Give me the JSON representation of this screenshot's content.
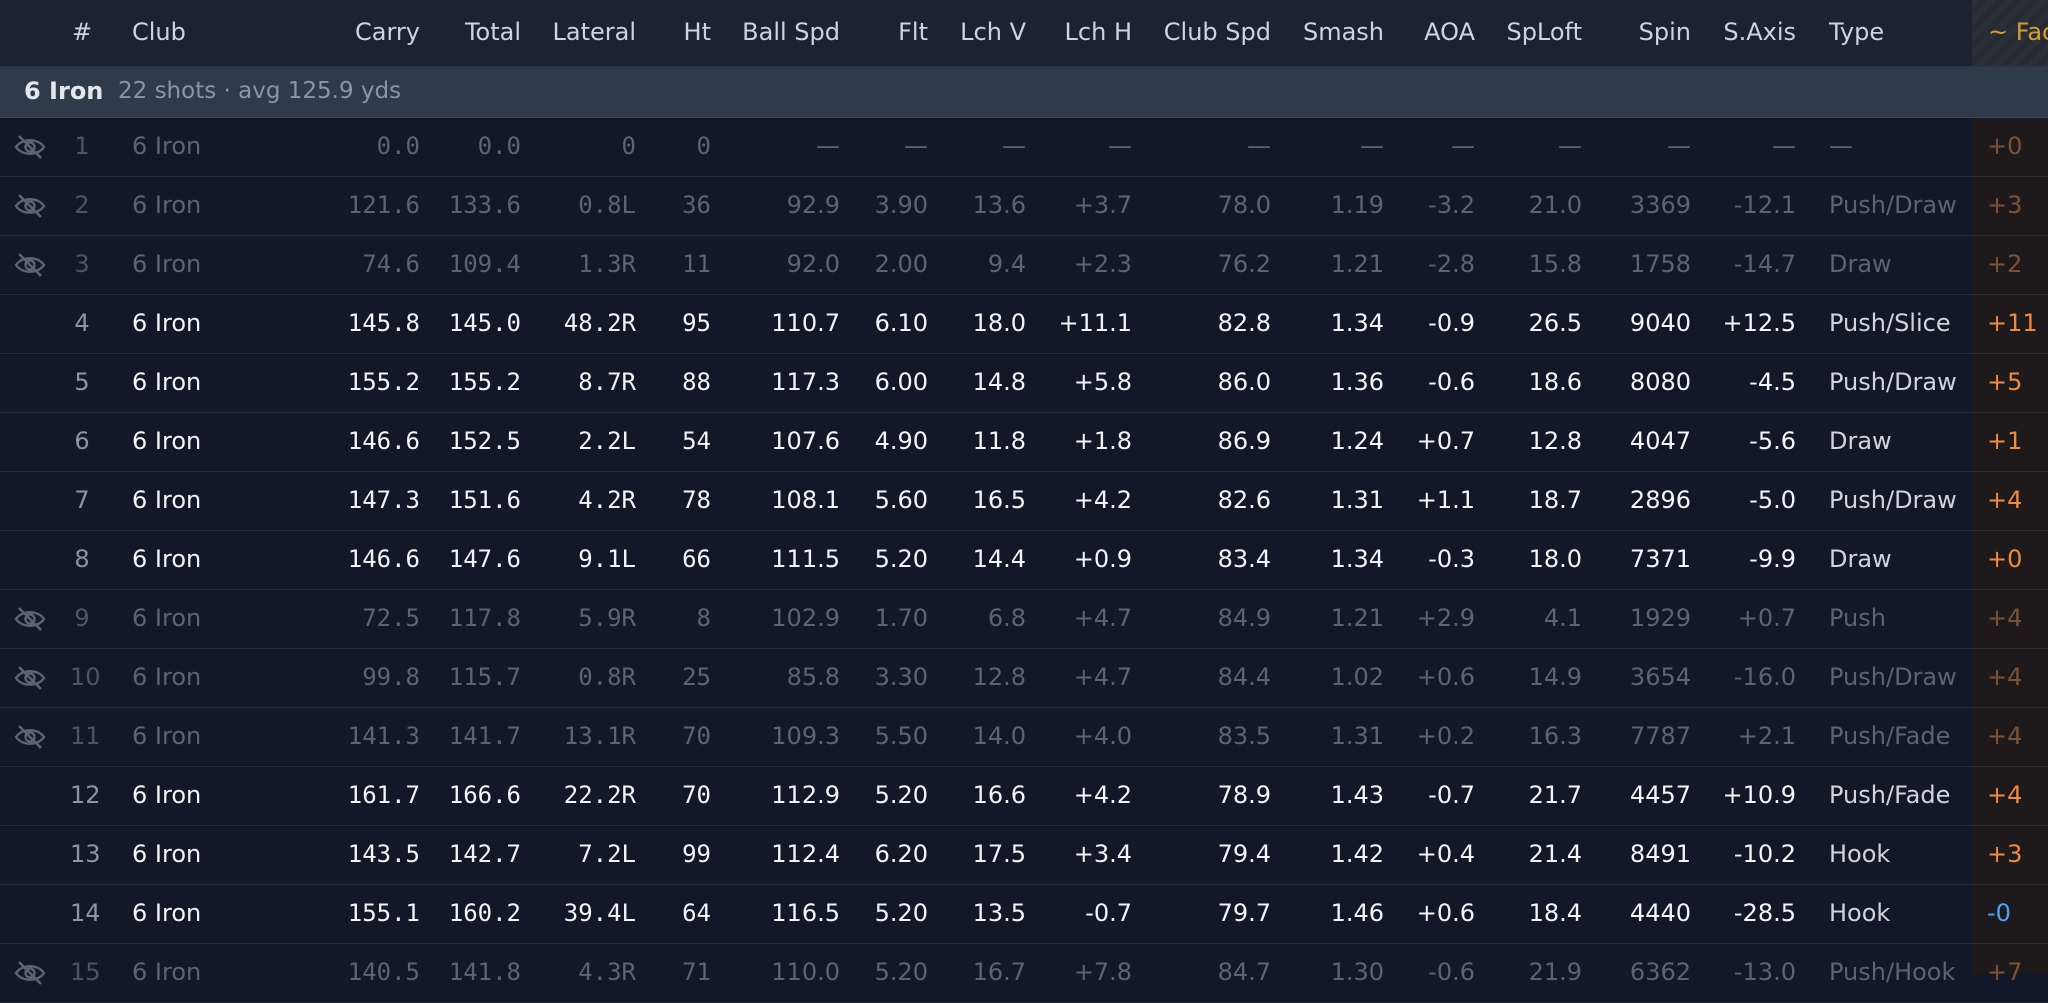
{
  "columns": {
    "hash": "#",
    "club": "Club",
    "carry": "Carry",
    "total": "Total",
    "lateral": "Lateral",
    "ht": "Ht",
    "ball_spd": "Ball Spd",
    "flt": "Flt",
    "lch_v": "Lch V",
    "lch_h": "Lch H",
    "club_spd": "Club Spd",
    "smash": "Smash",
    "aoa": "AOA",
    "sploft": "SpLoft",
    "spin": "Spin",
    "s_axis": "S.Axis",
    "type": "Type",
    "face": "~ Fac"
  },
  "group": {
    "name": "6 Iron",
    "meta": "22 shots · avg 125.9 yds"
  },
  "colors": {
    "background": "#111827",
    "face_positive": "#f08a3c",
    "face_negative": "#4aa3ff",
    "face_header": "#d69e2e"
  },
  "rows": [
    {
      "hidden": true,
      "n": "1",
      "club": "6 Iron",
      "carry": "0.0",
      "total": "0.0",
      "lateral": "0",
      "ht": "0",
      "ball_spd": "—",
      "flt": "—",
      "lch_v": "—",
      "lch_h": "—",
      "club_spd": "—",
      "smash": "—",
      "aoa": "—",
      "sploft": "—",
      "spin": "—",
      "s_axis": "—",
      "type": "—",
      "face": "+0"
    },
    {
      "hidden": true,
      "n": "2",
      "club": "6 Iron",
      "carry": "121.6",
      "total": "133.6",
      "lateral": "0.8L",
      "ht": "36",
      "ball_spd": "92.9",
      "flt": "3.90",
      "lch_v": "13.6",
      "lch_h": "+3.7",
      "club_spd": "78.0",
      "smash": "1.19",
      "aoa": "-3.2",
      "sploft": "21.0",
      "spin": "3369",
      "s_axis": "-12.1",
      "type": "Push/Draw",
      "face": "+3"
    },
    {
      "hidden": true,
      "n": "3",
      "club": "6 Iron",
      "carry": "74.6",
      "total": "109.4",
      "lateral": "1.3R",
      "ht": "11",
      "ball_spd": "92.0",
      "flt": "2.00",
      "lch_v": "9.4",
      "lch_h": "+2.3",
      "club_spd": "76.2",
      "smash": "1.21",
      "aoa": "-2.8",
      "sploft": "15.8",
      "spin": "1758",
      "s_axis": "-14.7",
      "type": "Draw",
      "face": "+2"
    },
    {
      "hidden": false,
      "n": "4",
      "club": "6 Iron",
      "carry": "145.8",
      "total": "145.0",
      "lateral": "48.2R",
      "ht": "95",
      "ball_spd": "110.7",
      "flt": "6.10",
      "lch_v": "18.0",
      "lch_h": "+11.1",
      "club_spd": "82.8",
      "smash": "1.34",
      "aoa": "-0.9",
      "sploft": "26.5",
      "spin": "9040",
      "s_axis": "+12.5",
      "type": "Push/Slice",
      "face": "+11"
    },
    {
      "hidden": false,
      "n": "5",
      "club": "6 Iron",
      "carry": "155.2",
      "total": "155.2",
      "lateral": "8.7R",
      "ht": "88",
      "ball_spd": "117.3",
      "flt": "6.00",
      "lch_v": "14.8",
      "lch_h": "+5.8",
      "club_spd": "86.0",
      "smash": "1.36",
      "aoa": "-0.6",
      "sploft": "18.6",
      "spin": "8080",
      "s_axis": "-4.5",
      "type": "Push/Draw",
      "face": "+5"
    },
    {
      "hidden": false,
      "n": "6",
      "club": "6 Iron",
      "carry": "146.6",
      "total": "152.5",
      "lateral": "2.2L",
      "ht": "54",
      "ball_spd": "107.6",
      "flt": "4.90",
      "lch_v": "11.8",
      "lch_h": "+1.8",
      "club_spd": "86.9",
      "smash": "1.24",
      "aoa": "+0.7",
      "sploft": "12.8",
      "spin": "4047",
      "s_axis": "-5.6",
      "type": "Draw",
      "face": "+1"
    },
    {
      "hidden": false,
      "n": "7",
      "club": "6 Iron",
      "carry": "147.3",
      "total": "151.6",
      "lateral": "4.2R",
      "ht": "78",
      "ball_spd": "108.1",
      "flt": "5.60",
      "lch_v": "16.5",
      "lch_h": "+4.2",
      "club_spd": "82.6",
      "smash": "1.31",
      "aoa": "+1.1",
      "sploft": "18.7",
      "spin": "2896",
      "s_axis": "-5.0",
      "type": "Push/Draw",
      "face": "+4"
    },
    {
      "hidden": false,
      "n": "8",
      "club": "6 Iron",
      "carry": "146.6",
      "total": "147.6",
      "lateral": "9.1L",
      "ht": "66",
      "ball_spd": "111.5",
      "flt": "5.20",
      "lch_v": "14.4",
      "lch_h": "+0.9",
      "club_spd": "83.4",
      "smash": "1.34",
      "aoa": "-0.3",
      "sploft": "18.0",
      "spin": "7371",
      "s_axis": "-9.9",
      "type": "Draw",
      "face": "+0"
    },
    {
      "hidden": true,
      "n": "9",
      "club": "6 Iron",
      "carry": "72.5",
      "total": "117.8",
      "lateral": "5.9R",
      "ht": "8",
      "ball_spd": "102.9",
      "flt": "1.70",
      "lch_v": "6.8",
      "lch_h": "+4.7",
      "club_spd": "84.9",
      "smash": "1.21",
      "aoa": "+2.9",
      "sploft": "4.1",
      "spin": "1929",
      "s_axis": "+0.7",
      "type": "Push",
      "face": "+4"
    },
    {
      "hidden": true,
      "n": "10",
      "club": "6 Iron",
      "carry": "99.8",
      "total": "115.7",
      "lateral": "0.8R",
      "ht": "25",
      "ball_spd": "85.8",
      "flt": "3.30",
      "lch_v": "12.8",
      "lch_h": "+4.7",
      "club_spd": "84.4",
      "smash": "1.02",
      "aoa": "+0.6",
      "sploft": "14.9",
      "spin": "3654",
      "s_axis": "-16.0",
      "type": "Push/Draw",
      "face": "+4"
    },
    {
      "hidden": true,
      "n": "11",
      "club": "6 Iron",
      "carry": "141.3",
      "total": "141.7",
      "lateral": "13.1R",
      "ht": "70",
      "ball_spd": "109.3",
      "flt": "5.50",
      "lch_v": "14.0",
      "lch_h": "+4.0",
      "club_spd": "83.5",
      "smash": "1.31",
      "aoa": "+0.2",
      "sploft": "16.3",
      "spin": "7787",
      "s_axis": "+2.1",
      "type": "Push/Fade",
      "face": "+4"
    },
    {
      "hidden": false,
      "n": "12",
      "club": "6 Iron",
      "carry": "161.7",
      "total": "166.6",
      "lateral": "22.2R",
      "ht": "70",
      "ball_spd": "112.9",
      "flt": "5.20",
      "lch_v": "16.6",
      "lch_h": "+4.2",
      "club_spd": "78.9",
      "smash": "1.43",
      "aoa": "-0.7",
      "sploft": "21.7",
      "spin": "4457",
      "s_axis": "+10.9",
      "type": "Push/Fade",
      "face": "+4"
    },
    {
      "hidden": false,
      "n": "13",
      "club": "6 Iron",
      "carry": "143.5",
      "total": "142.7",
      "lateral": "7.2L",
      "ht": "99",
      "ball_spd": "112.4",
      "flt": "6.20",
      "lch_v": "17.5",
      "lch_h": "+3.4",
      "club_spd": "79.4",
      "smash": "1.42",
      "aoa": "+0.4",
      "sploft": "21.4",
      "spin": "8491",
      "s_axis": "-10.2",
      "type": "Hook",
      "face": "+3"
    },
    {
      "hidden": false,
      "n": "14",
      "club": "6 Iron",
      "carry": "155.1",
      "total": "160.2",
      "lateral": "39.4L",
      "ht": "64",
      "ball_spd": "116.5",
      "flt": "5.20",
      "lch_v": "13.5",
      "lch_h": "-0.7",
      "club_spd": "79.7",
      "smash": "1.46",
      "aoa": "+0.6",
      "sploft": "18.4",
      "spin": "4440",
      "s_axis": "-28.5",
      "type": "Hook",
      "face": "-0"
    },
    {
      "hidden": true,
      "n": "15",
      "club": "6 Iron",
      "carry": "140.5",
      "total": "141.8",
      "lateral": "4.3R",
      "ht": "71",
      "ball_spd": "110.0",
      "flt": "5.20",
      "lch_v": "16.7",
      "lch_h": "+7.8",
      "club_spd": "84.7",
      "smash": "1.30",
      "aoa": "-0.6",
      "sploft": "21.9",
      "spin": "6362",
      "s_axis": "-13.0",
      "type": "Push/Hook",
      "face": "+7"
    }
  ]
}
